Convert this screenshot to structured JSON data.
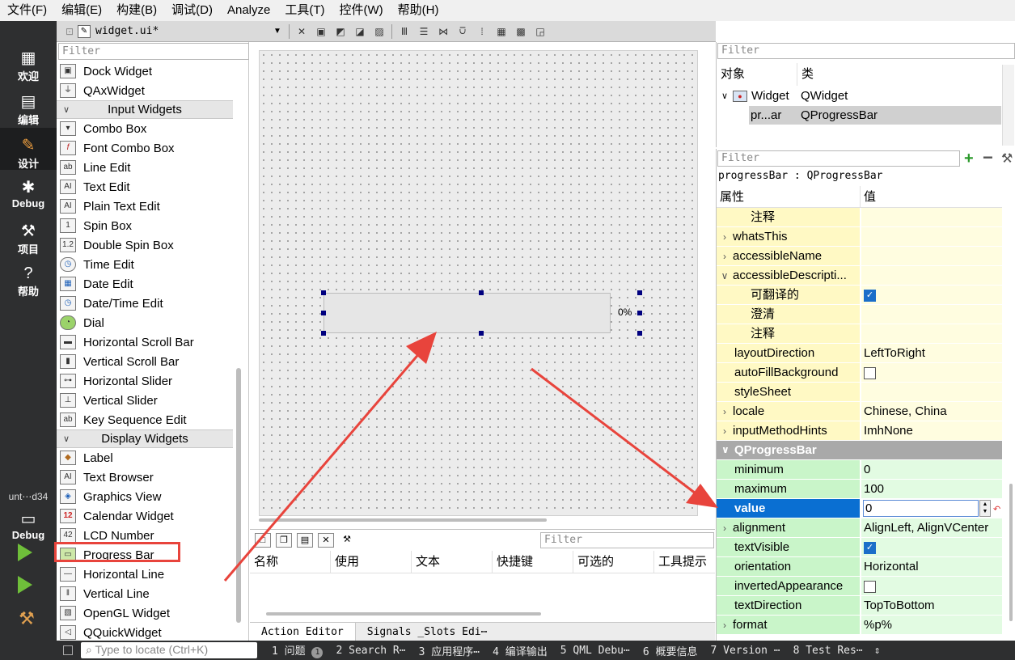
{
  "menubar": {
    "items": [
      "文件(F)",
      "编辑(E)",
      "构建(B)",
      "调试(D)",
      "Analyze",
      "工具(T)",
      "控件(W)",
      "帮助(H)"
    ]
  },
  "modebar": {
    "modes": [
      "欢迎",
      "编辑",
      "设计",
      "Debug",
      "项目",
      "帮助"
    ],
    "kit_label": "unt⋯d34",
    "kit_mode": "Debug"
  },
  "tabbar": {
    "file_name": "widget.ui*"
  },
  "widget_box": {
    "filter_placeholder": "Filter",
    "top_items": [
      "Dock Widget",
      "QAxWidget"
    ],
    "input_category": "Input Widgets",
    "input_items": [
      "Combo Box",
      "Font Combo Box",
      "Line Edit",
      "Text Edit",
      "Plain Text Edit",
      "Spin Box",
      "Double Spin Box",
      "Time Edit",
      "Date Edit",
      "Date/Time Edit",
      "Dial",
      "Horizontal Scroll Bar",
      "Vertical Scroll Bar",
      "Horizontal Slider",
      "Vertical Slider",
      "Key Sequence Edit"
    ],
    "display_category": "Display Widgets",
    "display_items": [
      "Label",
      "Text Browser",
      "Graphics View",
      "Calendar Widget",
      "LCD Number",
      "Progress Bar",
      "Horizontal Line",
      "Vertical Line",
      "OpenGL Widget",
      "QQuickWidget"
    ]
  },
  "canvas": {
    "progress_text": "0%"
  },
  "action_editor": {
    "filter_placeholder": "Filter",
    "columns": [
      "名称",
      "使用",
      "文本",
      "快捷键",
      "可选的",
      "工具提示"
    ],
    "tabs": [
      "Action Editor",
      "Signals _Slots Edi⋯"
    ]
  },
  "object_inspector": {
    "filter_placeholder": "Filter",
    "col_object": "对象",
    "col_class": "类",
    "rows": [
      {
        "object": "Widget",
        "class": "QWidget"
      },
      {
        "object": "pr...ar",
        "class": "QProgressBar"
      }
    ]
  },
  "property_editor": {
    "filter_placeholder": "Filter",
    "object_line": "progressBar : QProgressBar",
    "col_property": "属性",
    "col_value": "值",
    "rows": [
      {
        "name": "注释",
        "value": ""
      },
      {
        "name": "whatsThis",
        "value": ""
      },
      {
        "name": "accessibleName",
        "value": ""
      },
      {
        "name": "accessibleDescripti...",
        "value": ""
      },
      {
        "name": "可翻译的",
        "value": ""
      },
      {
        "name": "澄清",
        "value": ""
      },
      {
        "name": "注释",
        "value": ""
      },
      {
        "name": "layoutDirection",
        "value": "LeftToRight"
      },
      {
        "name": "autoFillBackground",
        "value": ""
      },
      {
        "name": "styleSheet",
        "value": ""
      },
      {
        "name": "locale",
        "value": "Chinese, China"
      },
      {
        "name": "inputMethodHints",
        "value": "ImhNone"
      },
      {
        "name": "QProgressBar",
        "value": ""
      },
      {
        "name": "minimum",
        "value": "0"
      },
      {
        "name": "maximum",
        "value": "100"
      },
      {
        "name": "value",
        "value": "0"
      },
      {
        "name": "alignment",
        "value": "AlignLeft, AlignVCenter"
      },
      {
        "name": "textVisible",
        "value": ""
      },
      {
        "name": "orientation",
        "value": "Horizontal"
      },
      {
        "name": "invertedAppearance",
        "value": ""
      },
      {
        "name": "textDirection",
        "value": "TopToBottom"
      },
      {
        "name": "format",
        "value": "%p%"
      }
    ]
  },
  "statusbar": {
    "locate_placeholder": "Type to locate (Ctrl+K)",
    "outputs": [
      "1 问题",
      "2 Search R⋯",
      "3 应用程序⋯",
      "4 编译输出",
      "5 QML Debu⋯",
      "6 概要信息",
      "7 Version ⋯",
      "8 Test Res⋯"
    ],
    "issues_badge": "1"
  },
  "colors": {
    "accent_arrow": "#e8443c",
    "selection": "#0a6fd2",
    "qobject_rows": "#fff9c4",
    "qprogressbar_rows": "#c9f5c9"
  }
}
